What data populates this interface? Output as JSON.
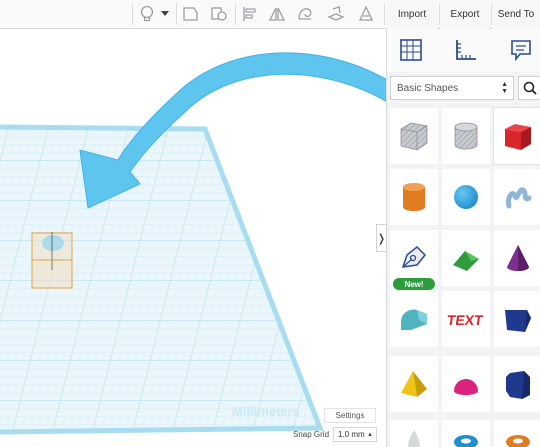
{
  "toolbar": {
    "icons": [
      "lightbulb-icon",
      "dropdown-arrow-icon",
      "group-icon",
      "ungroup-icon",
      "align-icon",
      "mirror-icon",
      "cruise-icon",
      "workplane-icon",
      "ruler-icon"
    ],
    "import_label": "Import",
    "export_label": "Export",
    "send_to_label": "Send To"
  },
  "workplane": {
    "units_label": "Millimeters",
    "settings_label": "Settings",
    "snap_grid_label": "Snap Grid",
    "snap_grid_value": "1.0 mm"
  },
  "panel": {
    "tools": [
      "workplane-tool-icon",
      "ruler-tool-icon",
      "notes-tool-icon"
    ],
    "category": "Basic Shapes",
    "shapes": [
      "box-hole",
      "cylinder-hole",
      "box",
      "cylinder",
      "sphere",
      "scribble",
      "shape-generator",
      "roof",
      "cone",
      "round-roof",
      "text",
      "wedge",
      "pyramid",
      "half-sphere",
      "polygon",
      "paraboloid",
      "torus",
      "tube"
    ],
    "new_badge": "New!"
  },
  "colors": {
    "arrow": "#5ec5ef",
    "grid": "#bfe6f3",
    "box": "#d9252c",
    "cylinder": "#e07b1f",
    "sphere": "#1e8fcf",
    "roof": "#2f9b3a",
    "cone": "#7d2f8f",
    "round_roof": "#4fb4c0",
    "text": "#d9252c",
    "wedge": "#1f3a8c",
    "pyramid": "#f0c417",
    "half_sphere": "#d9237f",
    "polygon": "#1f3a8c",
    "new_badge": "#2d9c3c"
  }
}
